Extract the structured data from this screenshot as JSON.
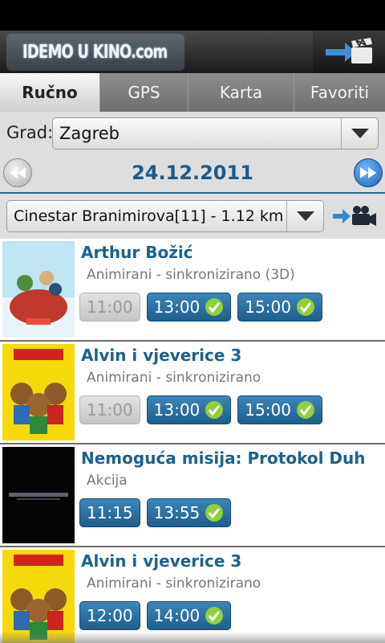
{
  "header": {
    "logo_text": "IDEMO U KINO.com",
    "action_icon": "film-clapper-arrow-icon"
  },
  "tabs": [
    {
      "label": "Ručno",
      "active": true
    },
    {
      "label": "GPS",
      "active": false
    },
    {
      "label": "Karta",
      "active": false
    },
    {
      "label": "Favoriti",
      "active": false
    }
  ],
  "filters": {
    "city_label": "Grad:",
    "city_value": "Zagreb",
    "date": "24.12.2011",
    "cinema_value": "Cinestar Branimirova[11] - 1.12 km"
  },
  "movies": [
    {
      "title": "Arthur Božić",
      "genre": "Animirani - sinkronizirano (3D)",
      "times": [
        {
          "t": "11:00",
          "past": true,
          "check": false
        },
        {
          "t": "13:00",
          "past": false,
          "check": true
        },
        {
          "t": "15:00",
          "past": false,
          "check": true
        }
      ]
    },
    {
      "title": "Alvin i vjeverice 3",
      "genre": "Animirani - sinkronizirano",
      "times": [
        {
          "t": "11:00",
          "past": true,
          "check": false
        },
        {
          "t": "13:00",
          "past": false,
          "check": true
        },
        {
          "t": "15:00",
          "past": false,
          "check": true
        }
      ]
    },
    {
      "title": "Nemoguća misija: Protokol Duh",
      "genre": "Akcija",
      "times": [
        {
          "t": "11:15",
          "past": false,
          "check": false
        },
        {
          "t": "13:55",
          "past": false,
          "check": true
        }
      ]
    },
    {
      "title": "Alvin i vjeverice 3",
      "genre": "Animirani - sinkronizirano",
      "times": [
        {
          "t": "12:00",
          "past": false,
          "check": false
        },
        {
          "t": "14:00",
          "past": false,
          "check": true
        }
      ]
    }
  ],
  "colors": {
    "accent": "#1a628f",
    "time_button": "#2a6fa0",
    "check": "#8fd13a"
  }
}
